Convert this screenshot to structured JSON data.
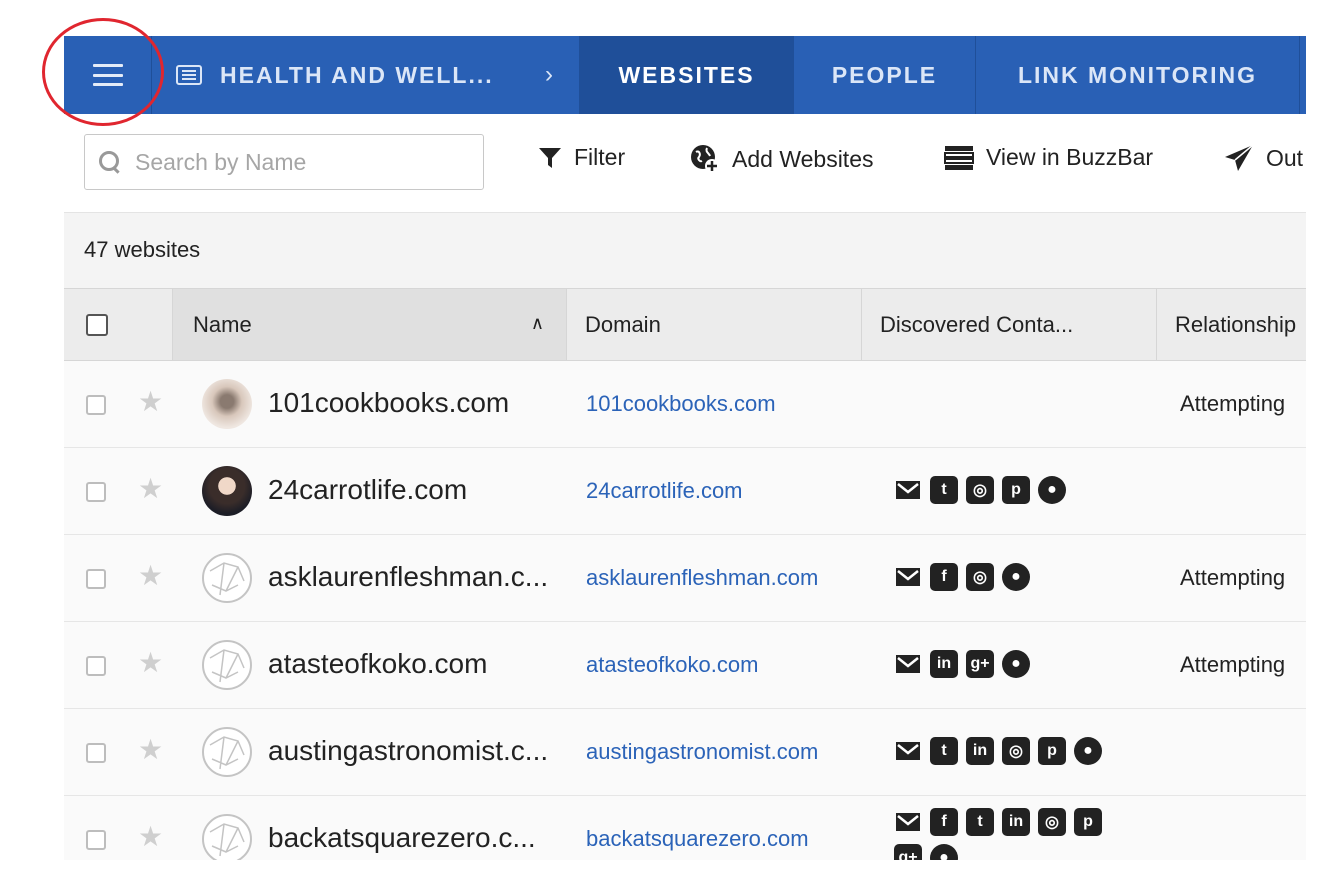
{
  "nav": {
    "breadcrumb": "HEALTH AND WELL...",
    "breadcrumb_chevron": "›",
    "tabs": [
      {
        "label": "WEBSITES",
        "active": true
      },
      {
        "label": "PEOPLE",
        "active": false
      },
      {
        "label": "LINK MONITORING",
        "active": false
      }
    ]
  },
  "toolbar": {
    "search_placeholder": "Search by Name",
    "filter_label": "Filter",
    "add_websites_label": "Add Websites",
    "view_buzzbar_label": "View in BuzzBar",
    "outreach_label": "Out"
  },
  "count_label": "47 websites",
  "table": {
    "columns": {
      "name": "Name",
      "domain": "Domain",
      "discovered": "Discovered Conta...",
      "relationship": "Relationship"
    },
    "rows": [
      {
        "name": "101cookbooks.com",
        "domain": "101cookbooks.com",
        "avatar": "photo",
        "icons": [],
        "relationship": "Attempting"
      },
      {
        "name": "24carrotlife.com",
        "domain": "24carrotlife.com",
        "avatar": "photo",
        "icons": [
          "email-icon",
          "twitter-icon",
          "instagram-icon",
          "pinterest-icon",
          "website-icon"
        ],
        "relationship": ""
      },
      {
        "name": "asklaurenfleshman.c...",
        "domain": "asklaurenfleshman.com",
        "avatar": "globe",
        "icons": [
          "email-icon",
          "facebook-icon",
          "instagram-icon",
          "website-icon"
        ],
        "relationship": "Attempting"
      },
      {
        "name": "atasteofkoko.com",
        "domain": "atasteofkoko.com",
        "avatar": "globe",
        "icons": [
          "email-icon",
          "linkedin-icon",
          "google-plus-icon",
          "website-icon"
        ],
        "relationship": "Attempting"
      },
      {
        "name": "austingastronomist.c...",
        "domain": "austingastronomist.com",
        "avatar": "globe",
        "icons": [
          "email-icon",
          "twitter-icon",
          "linkedin-icon",
          "instagram-icon",
          "pinterest-icon",
          "website-icon"
        ],
        "relationship": ""
      },
      {
        "name": "backatsquarezero.c...",
        "domain": "backatsquarezero.com",
        "avatar": "globe",
        "icons": [
          "email-icon",
          "facebook-icon",
          "twitter-icon",
          "linkedin-icon",
          "instagram-icon",
          "pinterest-icon",
          "google-plus-icon",
          "website-icon"
        ],
        "relationship": ""
      }
    ]
  },
  "colors": {
    "nav_bg": "#2960b5",
    "nav_active": "#1f4f99",
    "link": "#2b63b8",
    "annotation": "#e0262f"
  }
}
